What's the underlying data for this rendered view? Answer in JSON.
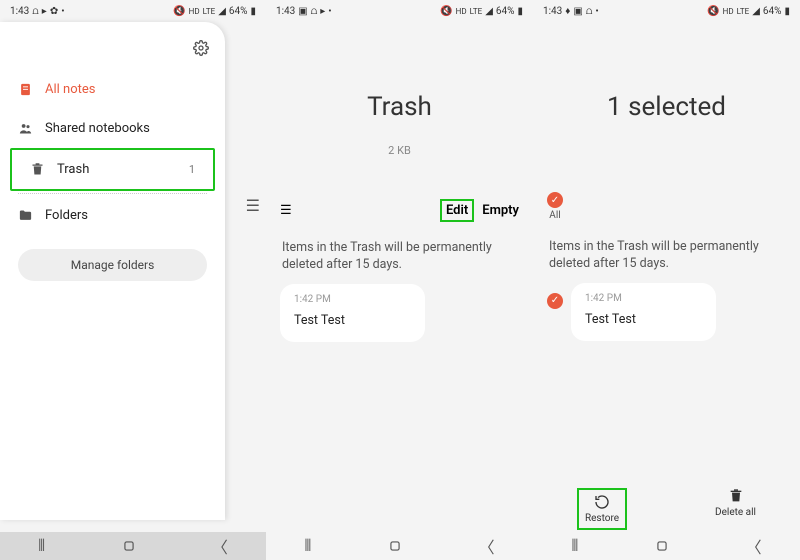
{
  "status": {
    "time": "1:43",
    "battery": "64%",
    "net": "LTE"
  },
  "drawer": {
    "all_notes": "All notes",
    "shared": "Shared notebooks",
    "trash": "Trash",
    "trash_count": "1",
    "folders": "Folders",
    "manage": "Manage folders"
  },
  "trash_screen": {
    "title": "Trash",
    "size": "2 KB",
    "edit": "Edit",
    "empty": "Empty",
    "info": "Items in the Trash will be permanently deleted after 15 days.",
    "note_time": "1:42 PM",
    "note_title": "Test Test"
  },
  "select_screen": {
    "title": "1 selected",
    "all": "All",
    "info": "Items in the Trash will be permanently deleted after 15 days.",
    "note_time": "1:42 PM",
    "note_title": "Test Test",
    "restore": "Restore",
    "delete_all": "Delete all"
  }
}
